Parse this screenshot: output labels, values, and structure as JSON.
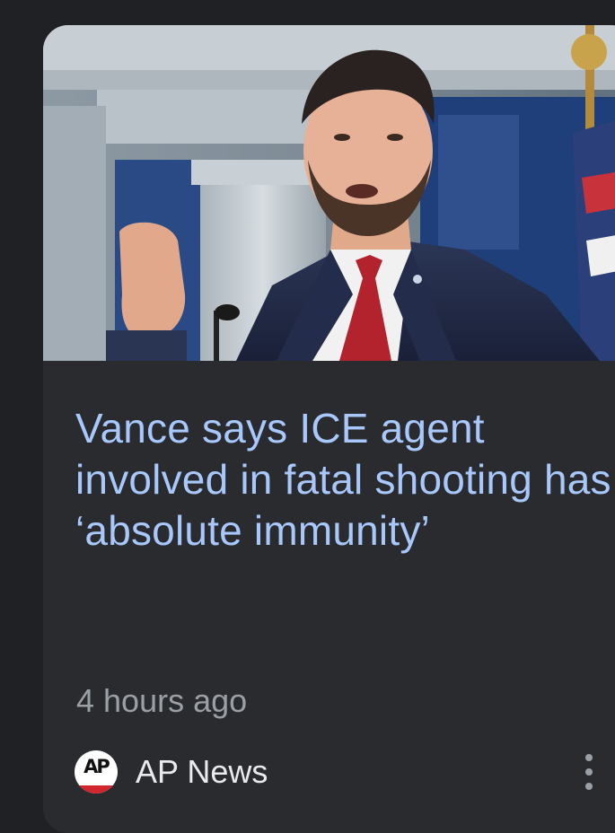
{
  "card": {
    "image": {
      "description_icon": "news-photo"
    },
    "headline": "Vance says ICE agent involved in fatal shooting has ‘absolute immunity’",
    "time_ago": "4 hours ago",
    "source": {
      "logo_text": "AP",
      "name": "AP News"
    },
    "menu_icon": "more-vert-icon"
  },
  "colors": {
    "background": "#202124",
    "card": "#2a2b2e",
    "headline": "#a8c7fa",
    "meta": "#9aa0a6",
    "source_text": "#e8eaed",
    "ap_red": "#d0272e"
  }
}
